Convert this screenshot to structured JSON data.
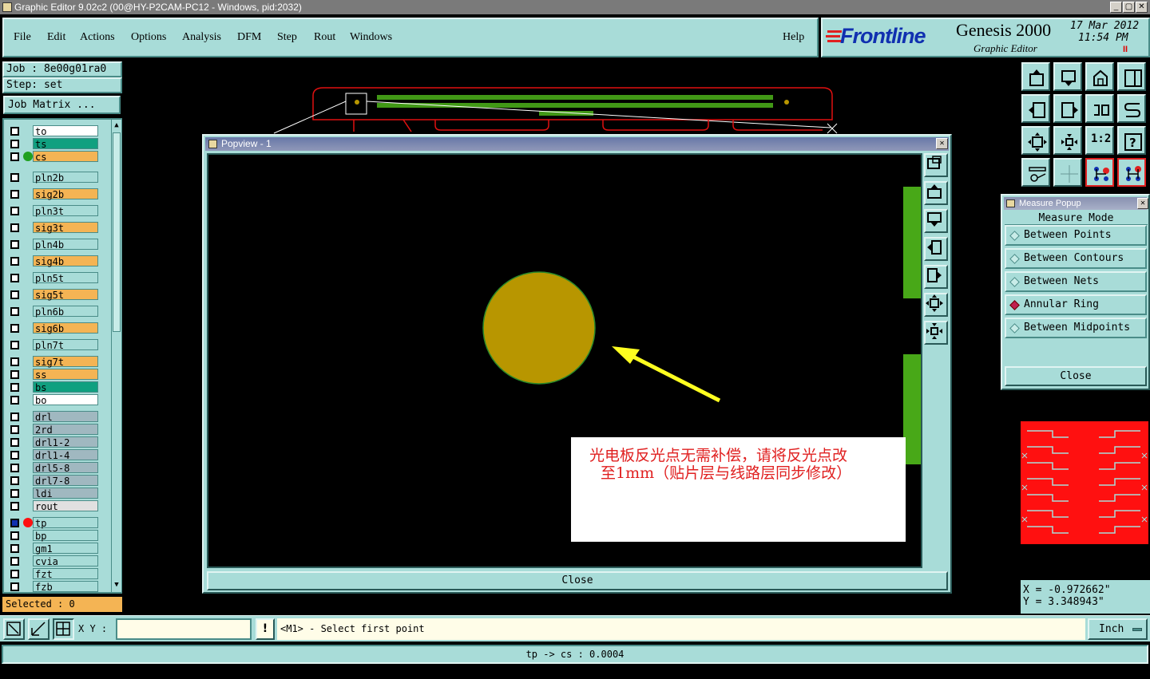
{
  "window": {
    "title": "Graphic Editor 9.02c2 (00@HY-P2CAM-PC12 - Windows, pid:2032)",
    "min": "_",
    "max": "▢",
    "close": "✕"
  },
  "menu": {
    "items": [
      "File",
      "Edit",
      "Actions",
      "Options",
      "Analysis",
      "DFM",
      "Step",
      "Rout",
      "Windows"
    ],
    "help": "Help"
  },
  "brand": {
    "logo": "Frontline",
    "product": "Genesis 2000",
    "subtitle": "Graphic Editor",
    "date": "17 Mar 2012",
    "time": "11:54 PM",
    "pause": "II"
  },
  "job": {
    "job_label": "Job : 8e00g01ra0",
    "step_label": "Step: set",
    "matrix_button": "Job Matrix ..."
  },
  "layers": [
    {
      "name": "to",
      "color": "#ffffff"
    },
    {
      "name": "ts",
      "color": "#10a080"
    },
    {
      "name": "cs",
      "color": "#f4b454",
      "marker": "#20a020"
    },
    {
      "name": "pln2b",
      "color": "#a8dcd8"
    },
    {
      "name": "sig2b",
      "color": "#f4b454"
    },
    {
      "name": "pln3t",
      "color": "#a8dcd8"
    },
    {
      "name": "sig3t",
      "color": "#f4b454"
    },
    {
      "name": "pln4b",
      "color": "#a8dcd8"
    },
    {
      "name": "sig4b",
      "color": "#f4b454"
    },
    {
      "name": "pln5t",
      "color": "#a8dcd8"
    },
    {
      "name": "sig5t",
      "color": "#f4b454"
    },
    {
      "name": "pln6b",
      "color": "#a8dcd8"
    },
    {
      "name": "sig6b",
      "color": "#f4b454"
    },
    {
      "name": "pln7t",
      "color": "#a8dcd8"
    },
    {
      "name": "sig7t",
      "color": "#f4b454"
    },
    {
      "name": "ss",
      "color": "#f4b454"
    },
    {
      "name": "bs",
      "color": "#10a080"
    },
    {
      "name": "bo",
      "color": "#ffffff"
    },
    {
      "name": "drl",
      "color": "#a0b8c0"
    },
    {
      "name": "2rd",
      "color": "#a0b8c0"
    },
    {
      "name": "drl1-2",
      "color": "#a0b8c0"
    },
    {
      "name": "drl1-4",
      "color": "#a0b8c0"
    },
    {
      "name": "drl5-8",
      "color": "#a0b8c0"
    },
    {
      "name": "drl7-8",
      "color": "#a0b8c0"
    },
    {
      "name": "ldi",
      "color": "#a0b8c0"
    },
    {
      "name": "rout",
      "color": "#e0e0e0"
    },
    {
      "name": "tp",
      "color": "#a8dcd8",
      "marker": "#ff1010"
    },
    {
      "name": "bp",
      "color": "#a8dcd8"
    },
    {
      "name": "gm1",
      "color": "#a8dcd8"
    },
    {
      "name": "cvia",
      "color": "#a8dcd8"
    },
    {
      "name": "fzt",
      "color": "#a8dcd8"
    },
    {
      "name": "fzb",
      "color": "#a8dcd8"
    }
  ],
  "selected": "Selected : 0",
  "popview": {
    "title": "Popview - 1",
    "close": "Close",
    "annotation_line1": "光电板反光点无需补偿，请将反光点改",
    "annotation_line2": "至1mm（贴片层与线路层同步修改）"
  },
  "measure": {
    "title": "Measure Popup",
    "mode_label": "Measure Mode",
    "options": [
      "Between Points",
      "Between Contours",
      "Between Nets",
      "Annular Ring",
      "Between Midpoints"
    ],
    "selected": "Annular Ring",
    "close": "Close"
  },
  "coords": {
    "x": "X = -0.972662\"",
    "y": "Y = 3.348943\""
  },
  "bottom": {
    "xy_label": "X Y :",
    "xy_value": "",
    "prompt": "<M1> - Select first point",
    "units": "Inch",
    "status": "tp -> cs : 0.0004"
  },
  "colors": {
    "panel": "#a8dcd8",
    "pad": "#b89600",
    "arrow": "#ffff20",
    "annotation": "#e02020"
  }
}
